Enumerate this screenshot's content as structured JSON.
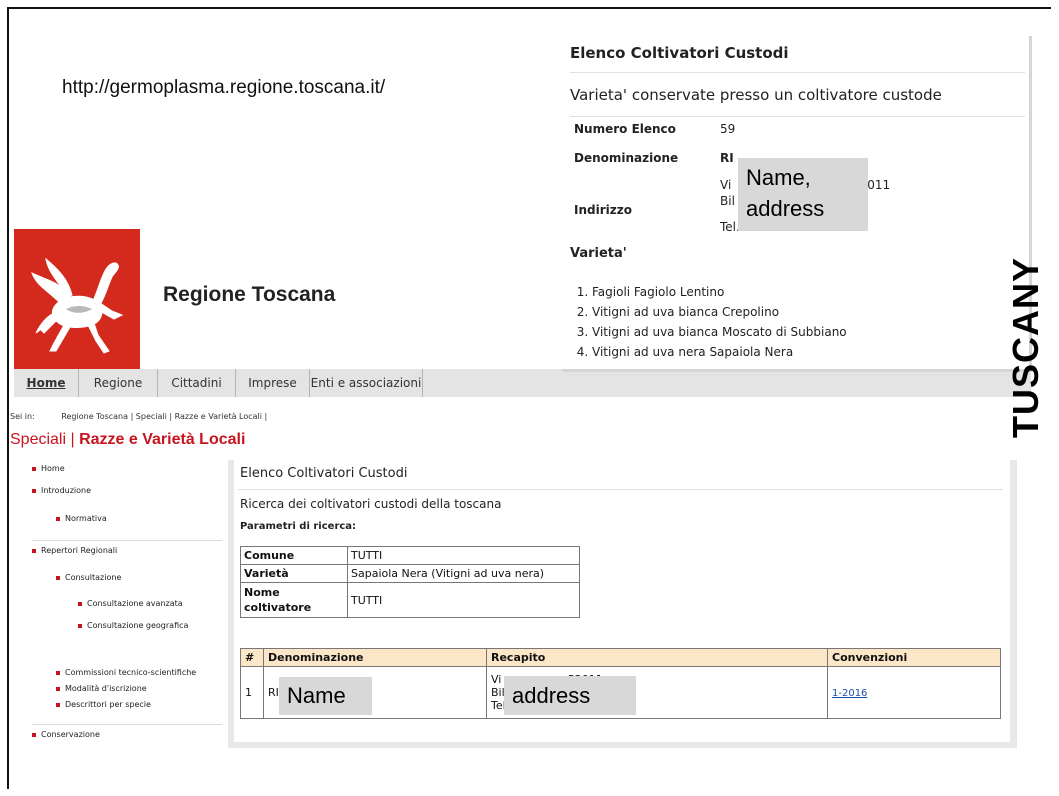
{
  "url_text": "http://germoplasma.regione.toscana.it/",
  "logo": {
    "name": "Regione Toscana",
    "color": "#d42a1e"
  },
  "nav": {
    "items": [
      "Home",
      "Regione",
      "Cittadini",
      "Imprese",
      "Enti e associazioni"
    ],
    "active": "Home"
  },
  "breadcrumb": {
    "label": "Sei in:",
    "path": "Regione Toscana  |  Speciali  |  Razze e Varietà Locali  |"
  },
  "section": {
    "prefix": "Speciali |",
    "title": "Razze e Varietà Locali"
  },
  "sidebar": {
    "home": "Home",
    "introduzione": "Introduzione",
    "normativa": "Normativa",
    "repertori": "Repertori Regionali",
    "consultazione": "Consultazione",
    "consultazione_avanzata": "Consultazione avanzata",
    "consultazione_geografica": "Consultazione geografica",
    "commissioni": "Commissioni tecnico-scientifiche",
    "modalita": "Modalità d'iscrizione",
    "descrittori": "Descrittori per specie",
    "conservazione": "Conservazione"
  },
  "main": {
    "title": "Elenco Coltivatori Custodi",
    "subtitle": "Ricerca dei coltivatori custodi della toscana",
    "params_label": "Parametri di ricerca:",
    "params": [
      {
        "key": "Comune",
        "value": "TUTTI"
      },
      {
        "key": "Varietà",
        "value": "Sapaiola Nera (Vitigni ad uva nera)"
      },
      {
        "key": "Nome coltivatore",
        "value": "TUTTI"
      }
    ],
    "results_headers": [
      "#",
      "Denominazione",
      "Recapito",
      "Convenzioni"
    ],
    "results_rows": [
      {
        "num": "1",
        "name_partial": "RI",
        "recapito_line1": "Vi",
        "recapito_line1_tail": "52011",
        "recapito_line2": "Bil",
        "recapito_line3": "Tel.",
        "convenzione": "1-2016"
      }
    ],
    "overlay_name": "Name",
    "overlay_address": "address"
  },
  "card": {
    "title": "Elenco Coltivatori Custodi",
    "subtitle": "Varieta' conservate presso un coltivatore custode",
    "numero_label": "Numero Elenco",
    "numero_value": "59",
    "denominazione_label": "Denominazione",
    "denominazione_partial": "RI",
    "indirizzo_label": "Indirizzo",
    "indirizzo_line1": "Vi",
    "indirizzo_tail": "52011",
    "indirizzo_line2": "Bil",
    "indirizzo_line3": "Tel.",
    "overlay": "Name,\naddress",
    "varieta_label": "Varieta'",
    "varieta": [
      "Fagioli Fagiolo Lentino",
      "Vitigni ad uva bianca Crepolino",
      "Vitigni ad uva bianca Moscato di Subbiano",
      "Vitigni ad uva nera Sapaiola Nera"
    ]
  },
  "side_label": "TUSCANY"
}
